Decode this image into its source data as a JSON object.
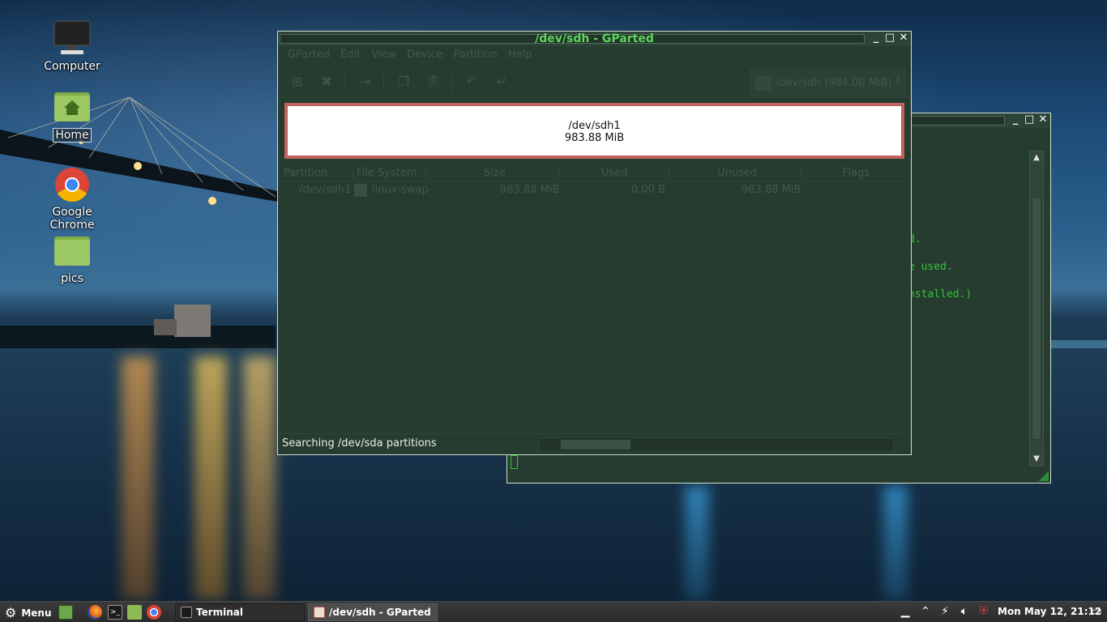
{
  "desktop": {
    "icons": [
      {
        "label": "Computer"
      },
      {
        "label": "Home"
      },
      {
        "label": "Google Chrome"
      },
      {
        "label": "pics"
      }
    ]
  },
  "terminal": {
    "lines": [
      "d.",
      "e used.",
      "nstalled.)"
    ]
  },
  "gparted": {
    "title": "/dev/sdh - GParted",
    "menu": [
      "GParted",
      "Edit",
      "View",
      "Device",
      "Partition",
      "Help"
    ],
    "device_selector": "/dev/sdh  (984.00 MiB)",
    "partition_map": {
      "name": "/dev/sdh1",
      "size": "983.88 MiB"
    },
    "columns": [
      "Partition",
      "File System",
      "Size",
      "Used",
      "Unused",
      "Flags"
    ],
    "rows": [
      {
        "partition": "/dev/sdh1",
        "filesystem": "linux-swap",
        "size": "983.88 MiB",
        "used": "0.00 B",
        "unused": "983.88 MiB",
        "flags": ""
      }
    ],
    "status": "Searching /dev/sda partitions",
    "progress_fraction": 0.2
  },
  "taskbar": {
    "menu_label": "Menu",
    "tasks": [
      {
        "label": "Terminal"
      },
      {
        "label": "/dev/sdh - GParted"
      }
    ],
    "clock": "Mon May 12, 21:12"
  },
  "colors": {
    "title_text": "#5cd65c",
    "partition_border": "#c0625d",
    "terminal_text": "#35c235"
  }
}
